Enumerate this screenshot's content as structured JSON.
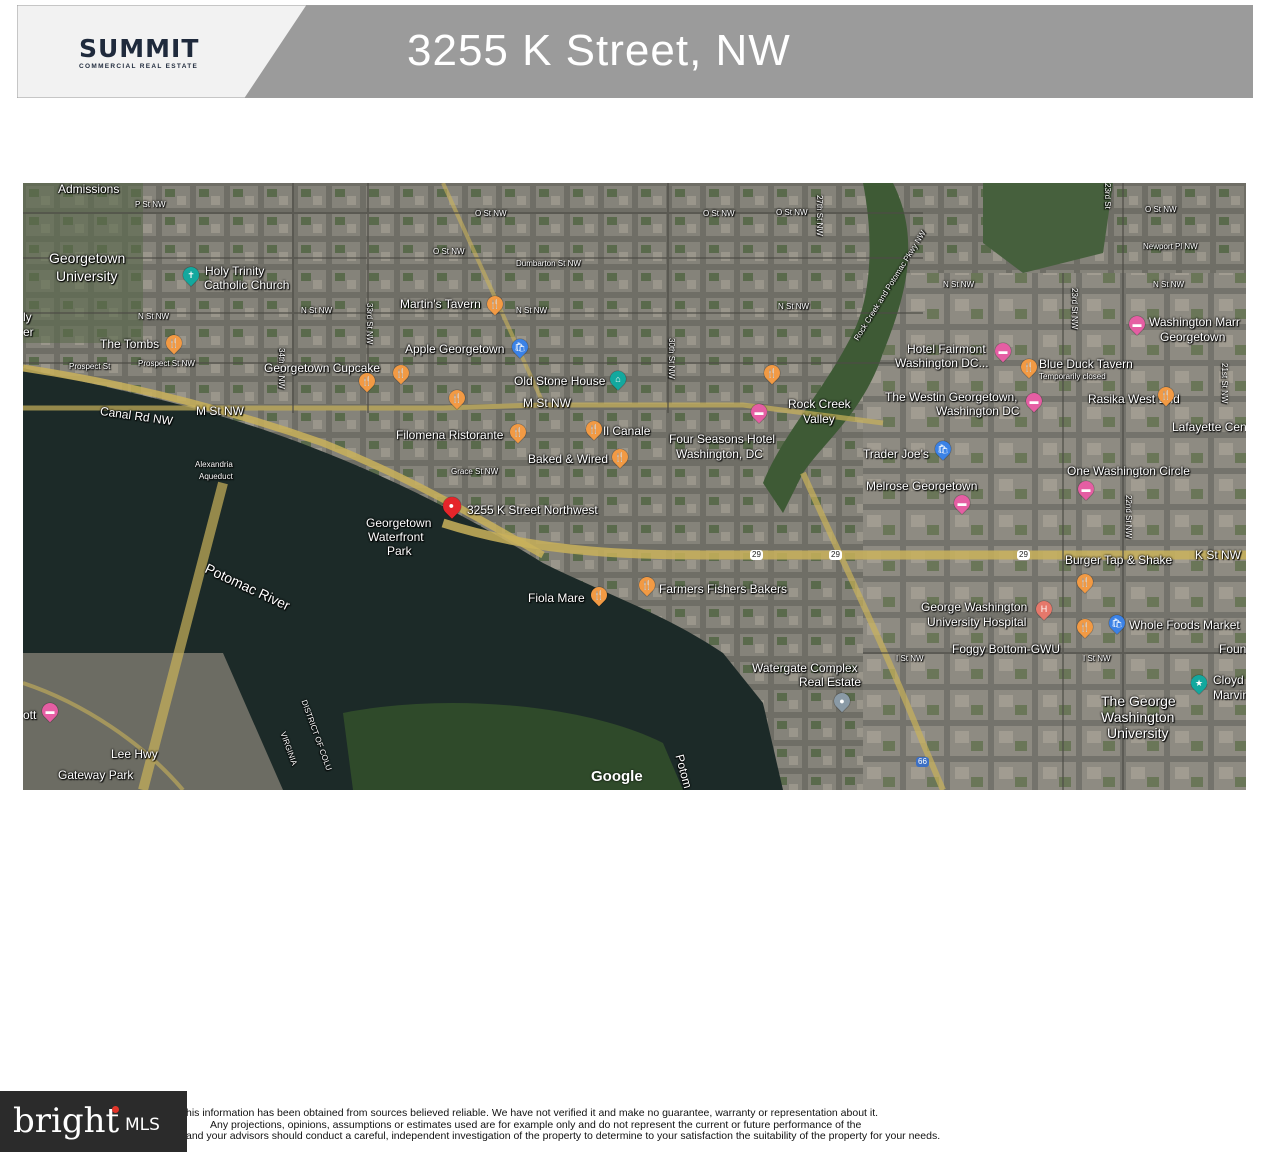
{
  "header": {
    "logo_main": "SUMMIT",
    "logo_sub": "COMMERCIAL REAL ESTATE",
    "title": "3255 K Street, NW",
    "colors": {
      "logo_panel": "#ffffff",
      "title_panel": "#9b9b9b"
    }
  },
  "map": {
    "attribution": "Google",
    "labels": {
      "admissions": "Admissions",
      "p_st": "P St NW",
      "georgetown_univ": "Georgetown",
      "georgetown_univ2": "University",
      "holy_trinity": "Holy Trinity",
      "holy_trinity2": "Catholic Church",
      "o_st_1": "O St NW",
      "o_st_2": "O St NW",
      "o_st_3": "O St NW",
      "o_st_4": "O St NW",
      "o_st_5": "O St NW",
      "dumbarton": "Dumbarton St NW",
      "n_st_1": "N St NW",
      "n_st_2": "N St NW",
      "n_st_3": "N St NW",
      "n_st_4": "N St NW",
      "n_st_5": "N St NW",
      "n_st_6": "N St NW",
      "newport": "Newport Pl NW",
      "st34": "34th St NW",
      "st33": "33rd St NW",
      "st30": "30th St NW",
      "st27": "27th St NW",
      "st23a": "23rd St",
      "st23b": "23rd St NW",
      "st22": "22nd St NW",
      "st21": "21st St NW",
      "martins": "Martin's Tavern",
      "the_tombs": "The Tombs",
      "prospect1": "Prospect St",
      "prospect2": "Prospect St NW",
      "apple": "Apple Georgetown",
      "cupcake": "Georgetown Cupcake",
      "old_stone": "Old Stone House",
      "canal": "Canal Rd NW",
      "m_st_1": "M St NW",
      "m_st_2": "M St NW",
      "filomena": "Filomena Ristorante",
      "il_canale": "Il Canale",
      "four_seasons": "Four Seasons Hotel",
      "four_seasons2": "Washington, DC",
      "rock_creek": "Rock Creek",
      "rock_creek2": "Valley",
      "rock_creek_pkwy": "Rock Creek and Potomac Pkwy NW",
      "fairmont": "Hotel Fairmont",
      "fairmont2": "Washington DC...",
      "blue_duck": "Blue Duck Tavern",
      "temp_closed": "Temporarily closed",
      "westin": "The Westin Georgetown,",
      "westin2": "Washington DC",
      "rasika": "Rasika West End",
      "lafayette": "Lafayette Cent",
      "washington_marr": "Washington Marr",
      "washington_marr2": "Georgetown",
      "alexandria": "Alexandria",
      "alexandria2": "Aqueduct",
      "grace": "Grace St NW",
      "baked": "Baked & Wired",
      "trader": "Trader Joe's",
      "one_wash": "One Washington Circle",
      "melrose": "Melrose Georgetown",
      "address": "3255 K Street Northwest",
      "waterfront": "Georgetown",
      "waterfront2": "Waterfront",
      "waterfront3": "Park",
      "potomac": "Potomac River",
      "k_st": "K St NW",
      "burger": "Burger Tap & Shake",
      "fiola": "Fiola Mare",
      "farmers": "Farmers Fishers Bakers",
      "gwu_hosp": "George Washington",
      "gwu_hosp2": "University Hospital",
      "whole_foods": "Whole Foods Market",
      "i_st_1": "I St NW",
      "i_st_2": "I St NW",
      "foggy": "Foggy Bottom-GWU",
      "found": "Found",
      "clyde": "Cloyd",
      "clyde2": "Marvin",
      "watergate": "Watergate Complex",
      "watergate2": "Real Estate",
      "george_wash": "The George",
      "george_wash2": "Washington",
      "george_wash3": "University",
      "marriott_cut": "ott",
      "lee_hwy": "Lee Hwy",
      "gateway": "Gateway Park",
      "district": "DISTRICT OF COLU",
      "virginia": "VIRGINIA",
      "potomac2": "Potom",
      "shield29a": "29",
      "shield29b": "29",
      "shield29c": "29",
      "shield66": "66",
      "ly": "ly",
      "er": "er"
    },
    "colors": {
      "water": "#1c2a28",
      "urban": "#7a7a72",
      "park": "#3e5a35",
      "road": "#c9b25a"
    }
  },
  "footer": {
    "disclaimer_1": "his information has been obtained from sources believed reliable. We have not verified it and make no guarantee, warranty or representation about it.",
    "disclaimer_2": "Any projections, opinions, assumptions or estimates used are for example only and do not represent the current or future performance of the",
    "disclaimer_3": "and your advisors should conduct a careful, independent investigation of the property to determine to your satisfaction the suitability of the property for your needs.",
    "bright_word": "bright",
    "bright_mls": "MLS"
  }
}
